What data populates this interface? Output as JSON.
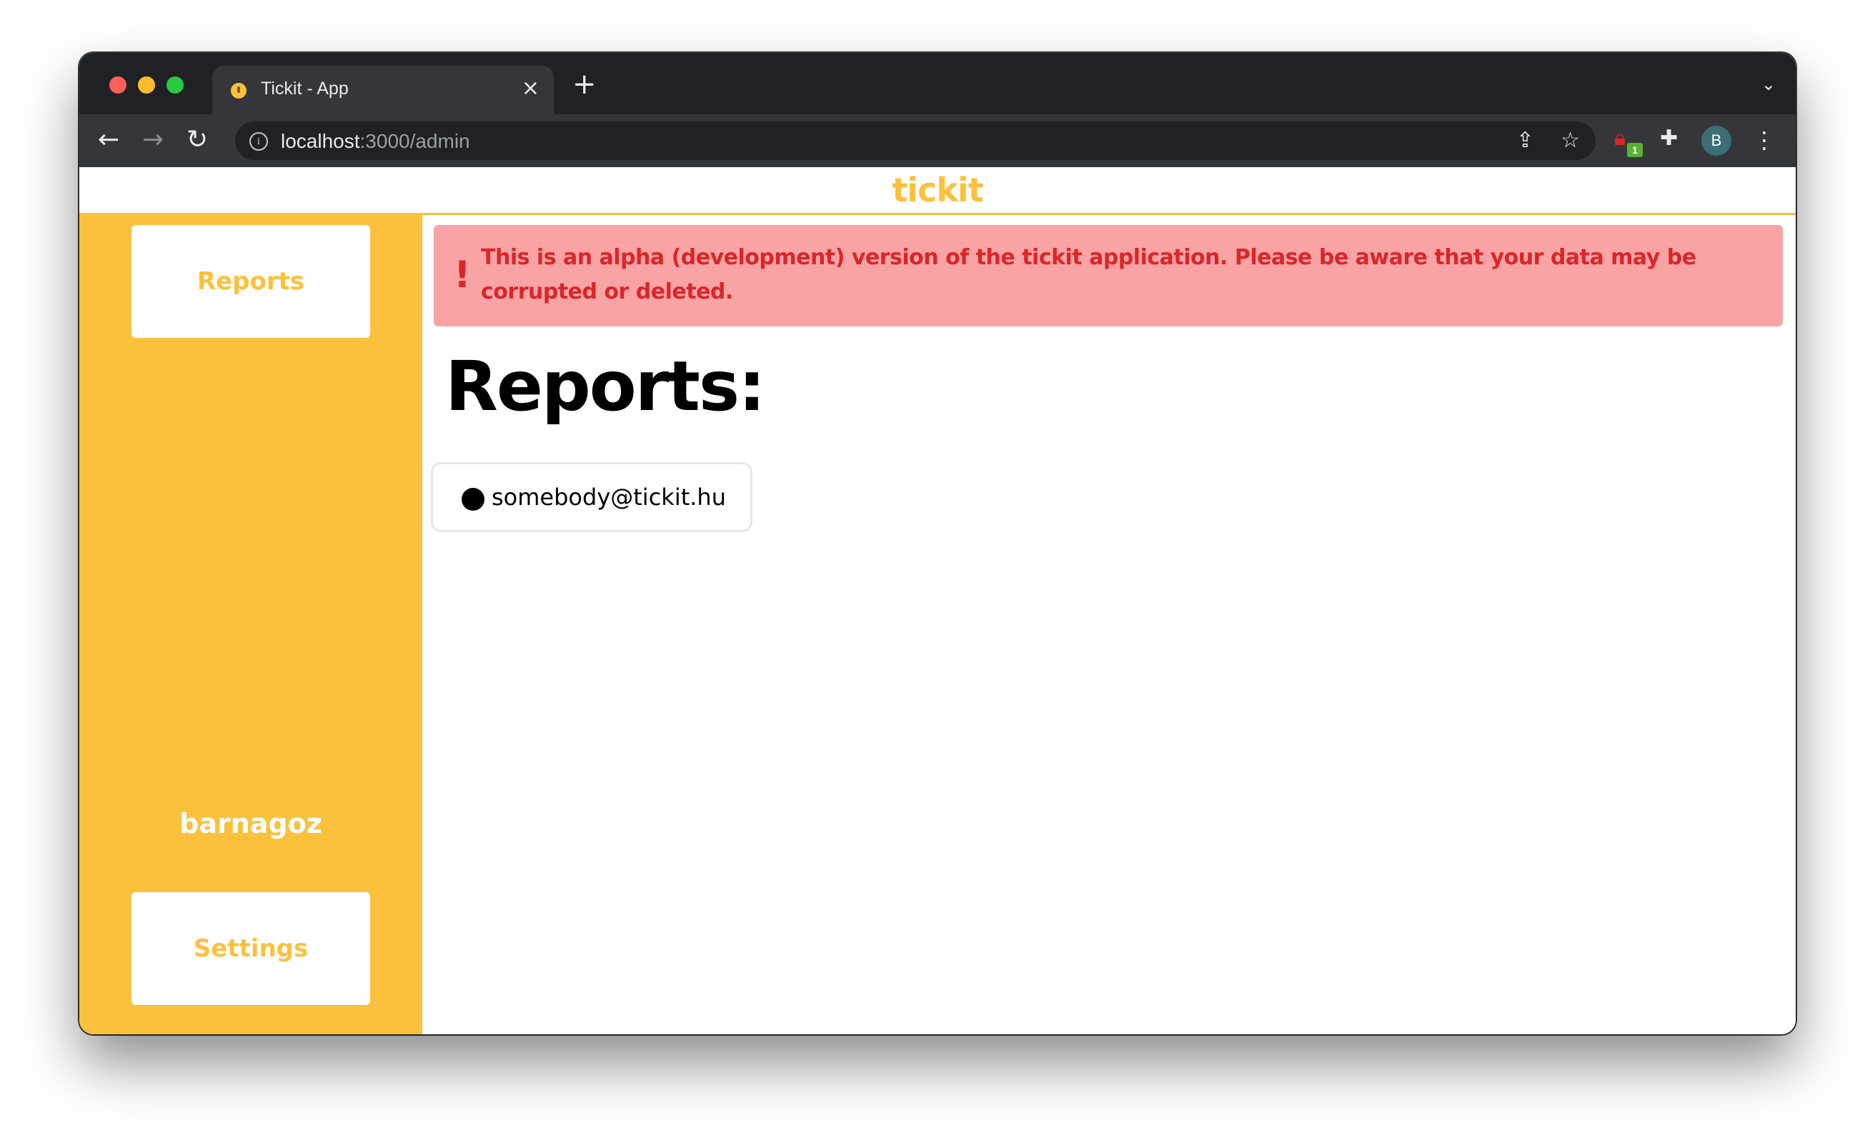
{
  "browser": {
    "tab_title": "Tickit - App",
    "tab_close": "×",
    "new_tab": "+",
    "url_host": "localhost",
    "url_rest": ":3000/admin",
    "avatar_letter": "B",
    "extension_badge": "1"
  },
  "app": {
    "brand": "tickit",
    "sidebar": {
      "reports_label": "Reports",
      "username": "barnagoz",
      "settings_label": "Settings"
    },
    "alert": {
      "icon": "!",
      "message": "This is an alpha (development) version of the tickit application. Please be aware that your data may be corrupted or deleted."
    },
    "page_title": "Reports:",
    "reports": [
      {
        "email": "somebody@tickit.hu"
      }
    ]
  },
  "colors": {
    "accent": "#fbc13c",
    "alert_bg": "#f9a3a5",
    "alert_text": "#d9262b"
  }
}
